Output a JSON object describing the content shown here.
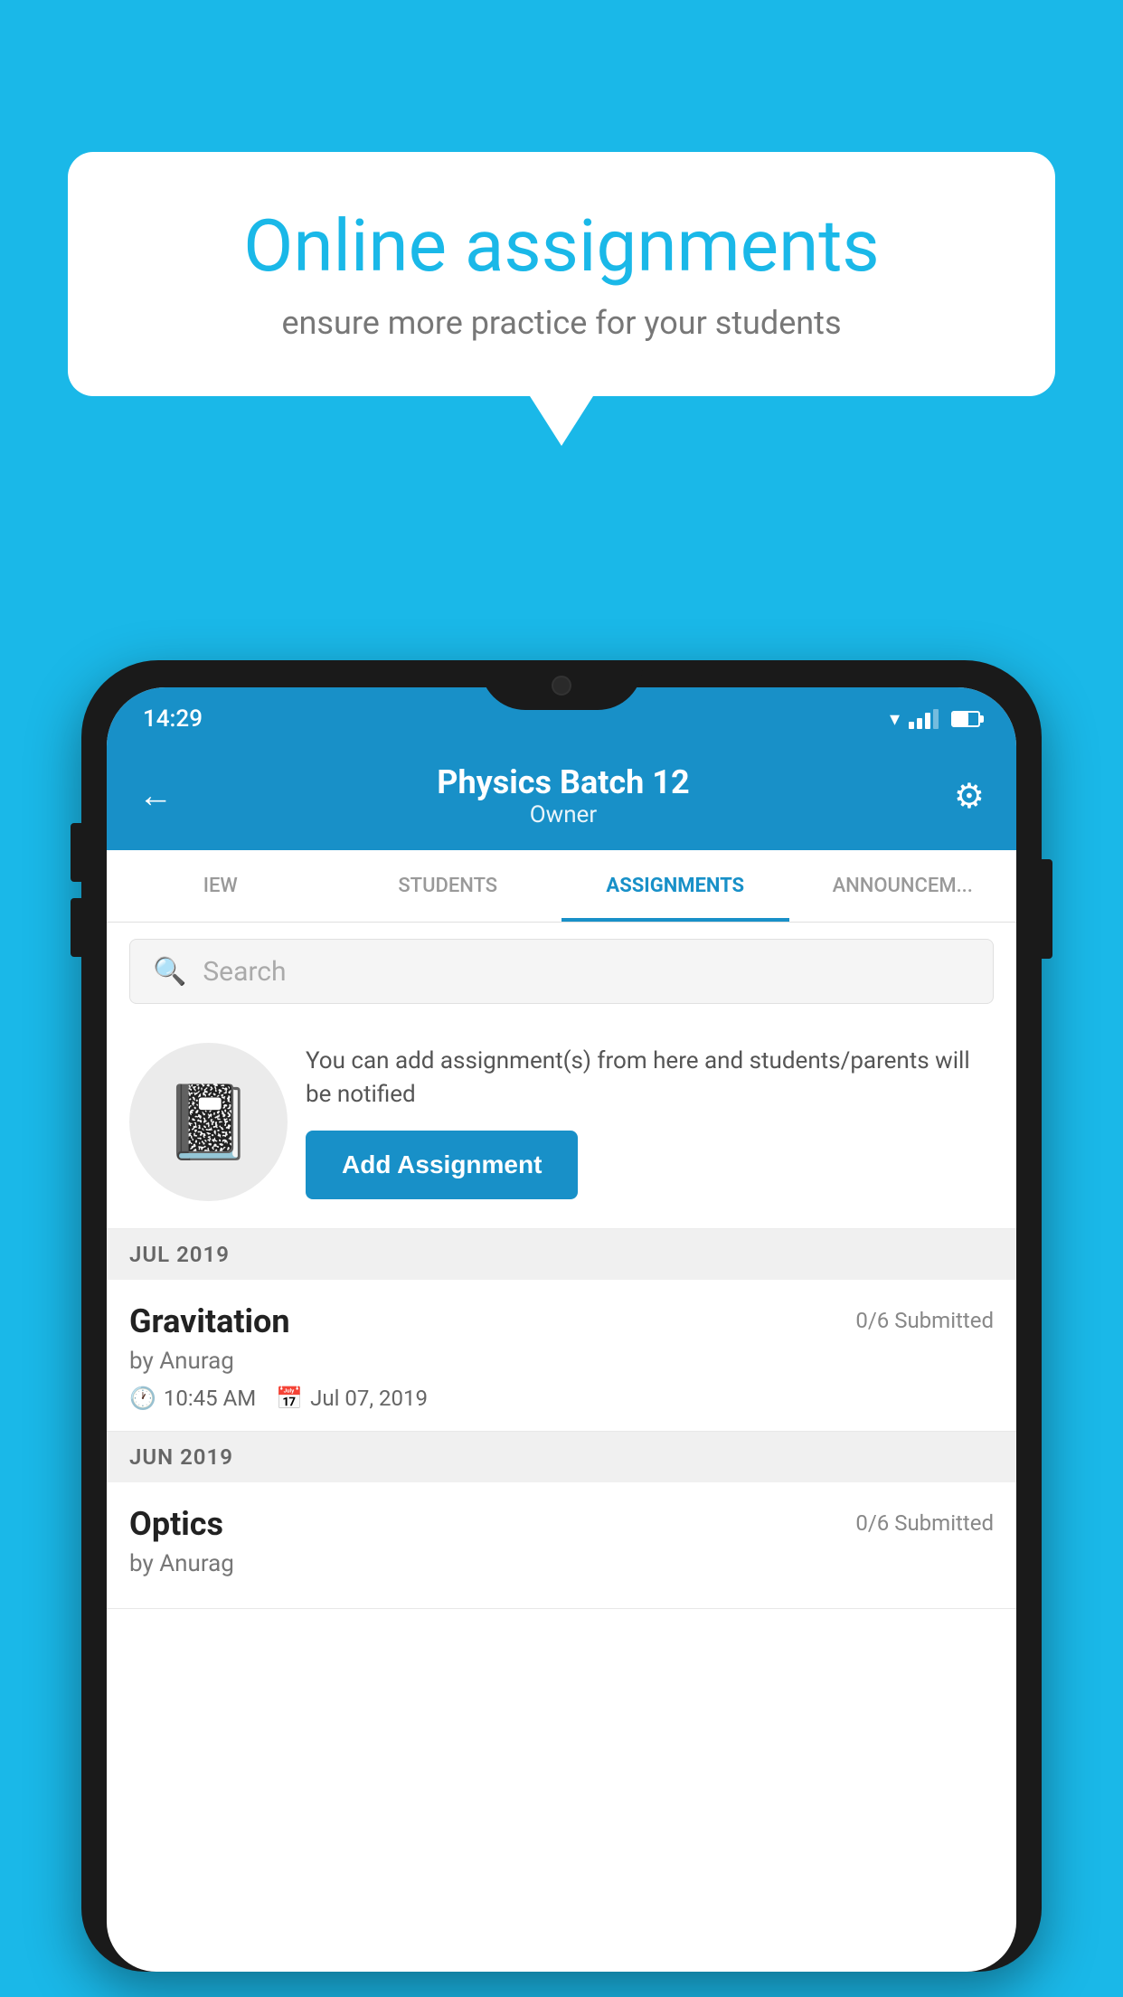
{
  "background_color": "#1AB8E8",
  "speech_bubble": {
    "title": "Online assignments",
    "subtitle": "ensure more practice for your students"
  },
  "phone": {
    "status_bar": {
      "time": "14:29"
    },
    "header": {
      "back_label": "←",
      "batch_title": "Physics Batch 12",
      "role": "Owner",
      "settings_label": "⚙"
    },
    "tabs": [
      {
        "label": "IEW",
        "active": false
      },
      {
        "label": "STUDENTS",
        "active": false
      },
      {
        "label": "ASSIGNMENTS",
        "active": true
      },
      {
        "label": "ANNOUNCEM...",
        "active": false
      }
    ],
    "search": {
      "placeholder": "Search"
    },
    "promo": {
      "text": "You can add assignment(s) from here and students/parents will be notified",
      "button_label": "Add Assignment"
    },
    "sections": [
      {
        "label": "JUL 2019",
        "items": [
          {
            "name": "Gravitation",
            "submitted": "0/6 Submitted",
            "by": "by Anurag",
            "time": "10:45 AM",
            "date": "Jul 07, 2019"
          }
        ]
      },
      {
        "label": "JUN 2019",
        "items": [
          {
            "name": "Optics",
            "submitted": "0/6 Submitted",
            "by": "by Anurag",
            "time": "",
            "date": ""
          }
        ]
      }
    ]
  }
}
